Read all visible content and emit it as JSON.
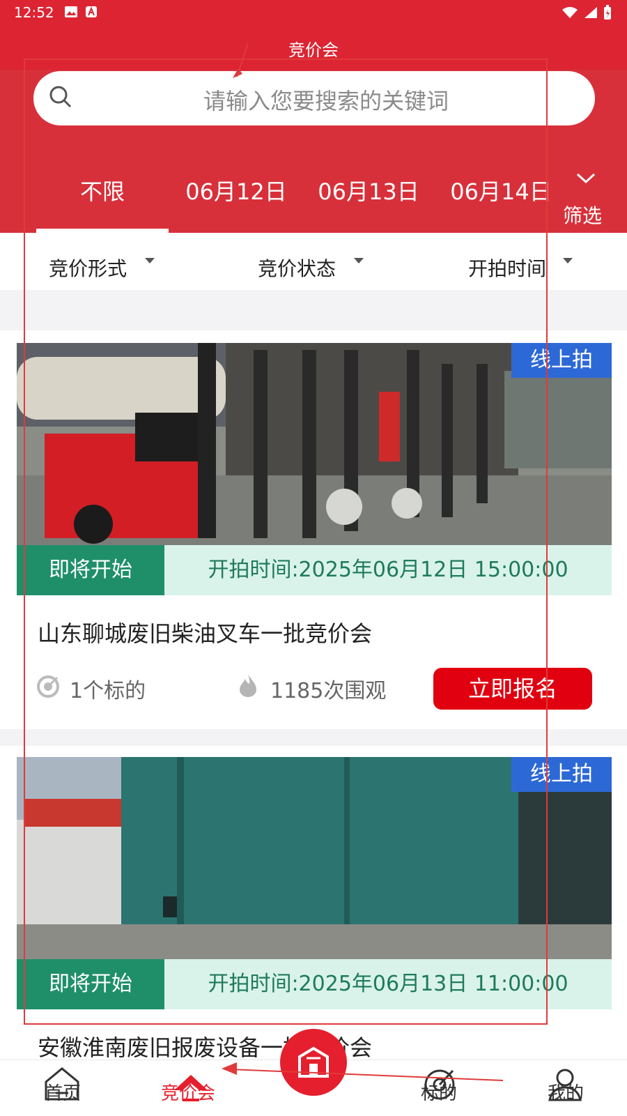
{
  "status_bar": {
    "time": "12:52"
  },
  "header": {
    "title": "竞价会"
  },
  "search": {
    "placeholder": "请输入您要搜索的关键词"
  },
  "date_tabs": [
    {
      "label": "不限",
      "active": true
    },
    {
      "label": "06月12日"
    },
    {
      "label": "06月13日"
    },
    {
      "label": "06月14日"
    }
  ],
  "filter": {
    "label": "筛选"
  },
  "dropdowns": [
    {
      "label": "竞价形式"
    },
    {
      "label": "竞价状态"
    },
    {
      "label": "开拍时间"
    }
  ],
  "cards": [
    {
      "badge": "线上拍",
      "status": "即将开始",
      "time": "开拍时间:2025年06月12日 15:00:00",
      "title": "山东聊城废旧柴油叉车一批竞价会",
      "targets": "1个标的",
      "views": "1185次围观",
      "button": "立即报名"
    },
    {
      "badge": "线上拍",
      "status": "即将开始",
      "time": "开拍时间:2025年06月13日 11:00:00",
      "title": "安徽淮南废旧报废设备一批竞价会"
    }
  ],
  "bottom_nav": [
    {
      "label": "首页"
    },
    {
      "label": "竞价会",
      "active": true
    },
    {
      "label": ""
    },
    {
      "label": "标的"
    },
    {
      "label": "我的"
    }
  ],
  "colors": {
    "brand_red": "#dc2433",
    "accent_green": "#1f8f6a",
    "badge_blue": "#2d69d6"
  }
}
